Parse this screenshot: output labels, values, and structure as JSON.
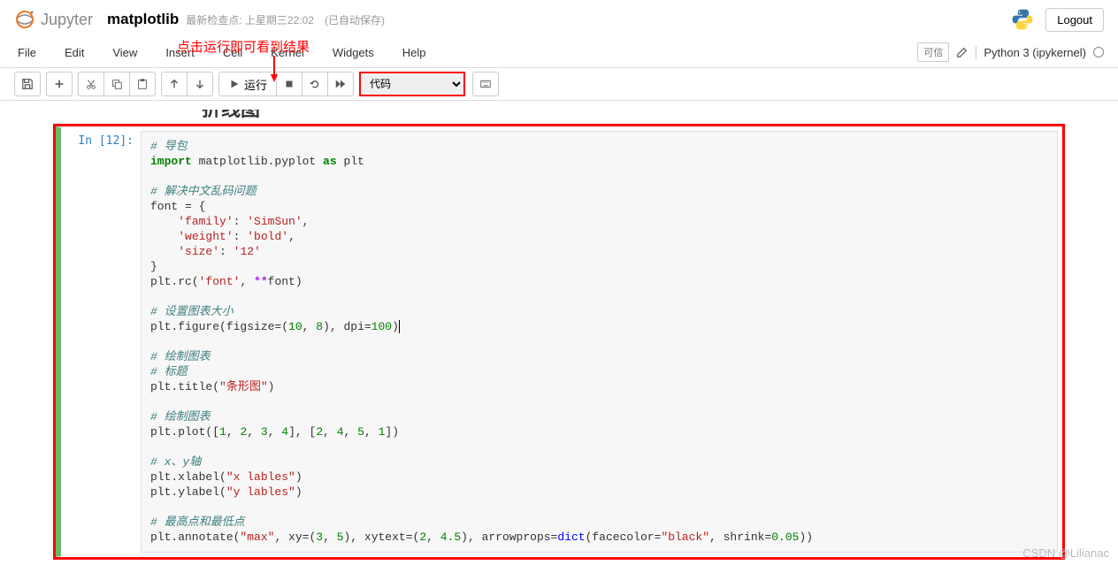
{
  "header": {
    "logo_text": "Jupyter",
    "notebook_name": "matplotlib",
    "checkpoint": "最新检查点: 上星期三22:02",
    "autosave": "(已自动保存)",
    "logout": "Logout"
  },
  "annotation": {
    "red_text": "点击运行即可看到结果"
  },
  "menu": {
    "items": [
      "File",
      "Edit",
      "View",
      "Insert",
      "Cell",
      "Kernel",
      "Widgets",
      "Help"
    ],
    "trusted": "可信",
    "kernel": "Python 3 (ipykernel)"
  },
  "toolbar": {
    "run_label": "运行",
    "cell_type": "代码"
  },
  "cell": {
    "prompt": "In  [12]:",
    "code": {
      "l1": "# 导包",
      "l2a": "import",
      "l2b": " matplotlib.pyplot ",
      "l2c": "as",
      "l2d": " plt",
      "l4": "# 解决中文乱码问题",
      "l5": "font = {",
      "l6a": "    ",
      "l6b": "'family'",
      "l6c": ": ",
      "l6d": "'SimSun'",
      "l6e": ",",
      "l7a": "    ",
      "l7b": "'weight'",
      "l7c": ": ",
      "l7d": "'bold'",
      "l7e": ",",
      "l8a": "    ",
      "l8b": "'size'",
      "l8c": ": ",
      "l8d": "'12'",
      "l9": "}",
      "l10a": "plt.rc(",
      "l10b": "'font'",
      "l10c": ", ",
      "l10d": "**",
      "l10e": "font)",
      "l12": "# 设置图表大小",
      "l13a": "plt.figure(figsize=(",
      "l13b": "10",
      "l13c": ", ",
      "l13d": "8",
      "l13e": "), dpi=",
      "l13f": "100",
      "l13g": ")",
      "l15": "# 绘制图表",
      "l16": "# 标题",
      "l17a": "plt.title(",
      "l17b": "\"条形图\"",
      "l17c": ")",
      "l19": "# 绘制图表",
      "l20a": "plt.plot([",
      "l20b": "1",
      "l20c": ", ",
      "l20d": "2",
      "l20e": ", ",
      "l20f": "3",
      "l20g": ", ",
      "l20h": "4",
      "l20i": "], [",
      "l20j": "2",
      "l20k": ", ",
      "l20l": "4",
      "l20m": ", ",
      "l20n": "5",
      "l20o": ", ",
      "l20p": "1",
      "l20q": "])",
      "l22": "# x、y轴",
      "l23a": "plt.xlabel(",
      "l23b": "\"x lables\"",
      "l23c": ")",
      "l24a": "plt.ylabel(",
      "l24b": "\"y lables\"",
      "l24c": ")",
      "l26": "# 最高点和最低点",
      "l27a": "plt.annotate(",
      "l27b": "\"max\"",
      "l27c": ", xy=(",
      "l27d": "3",
      "l27e": ", ",
      "l27f": "5",
      "l27g": "), xytext=(",
      "l27h": "2",
      "l27i": ", ",
      "l27j": "4.5",
      "l27k": "), arrowprops=",
      "l27l": "dict",
      "l27m": "(facecolor=",
      "l27n": "\"black\"",
      "l27o": ", shrink=",
      "l27p": "0.05",
      "l27q": "))"
    }
  },
  "heading_partial": "折线图",
  "watermark": "CSDN @Lilianac"
}
